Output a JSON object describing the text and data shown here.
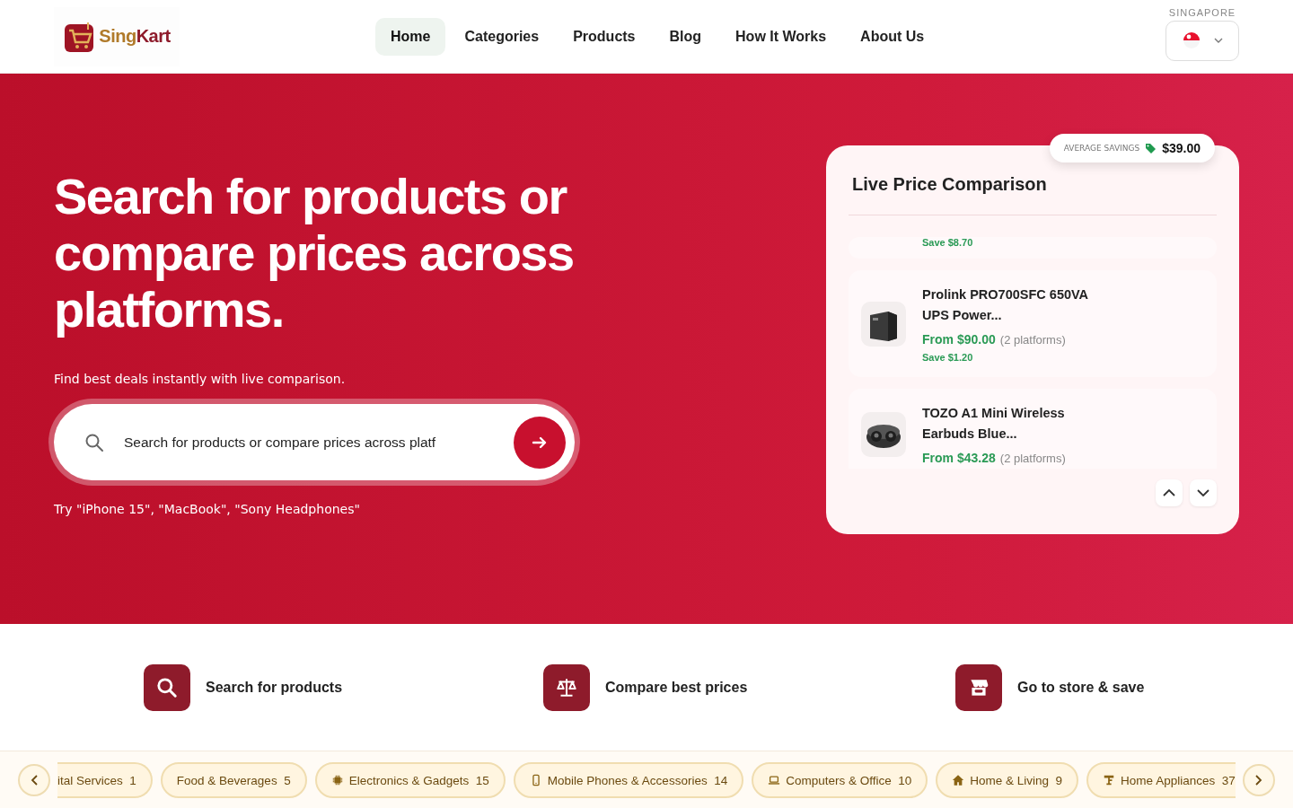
{
  "header": {
    "logo_parts": [
      "Sing",
      "Kart"
    ],
    "nav": [
      {
        "label": "Home",
        "selected": true
      },
      {
        "label": "Categories",
        "selected": false
      },
      {
        "label": "Products",
        "selected": false
      },
      {
        "label": "Blog",
        "selected": false
      },
      {
        "label": "How It Works",
        "selected": false
      },
      {
        "label": "About Us",
        "selected": false
      }
    ],
    "region_label": "SINGAPORE"
  },
  "hero": {
    "title": "Search for products or compare prices across platforms.",
    "subtitle": "Find best deals instantly with live comparison.",
    "search": {
      "placeholder": "Search for products or compare prices across platf"
    },
    "hint": "Try \"iPhone 15\", \"MacBook\", \"Sony Headphones\""
  },
  "comparison": {
    "badge_label": "AVERAGE SAVINGS",
    "badge_value": "$39.00",
    "title": "Live Price Comparison",
    "items": [
      {
        "saving": "Save $8.70"
      },
      {
        "kind": "ups",
        "name": "Prolink PRO700SFC 650VA UPS Power...",
        "price": "From $90.00",
        "platforms": "(2 platforms)",
        "saving": "Save $1.20"
      },
      {
        "kind": "earbuds",
        "name": "TOZO A1 Mini Wireless Earbuds Blue...",
        "price": "From $43.28",
        "platforms": "(2 platforms)"
      }
    ]
  },
  "steps": [
    {
      "kind": "search",
      "label": "Search for products"
    },
    {
      "kind": "scale",
      "label": "Compare best prices"
    },
    {
      "kind": "store",
      "label": "Go to store & save"
    }
  ],
  "categories": [
    {
      "kind": "none",
      "label": "ital Services",
      "count": "1"
    },
    {
      "kind": "none",
      "label": "Food & Beverages",
      "count": "5"
    },
    {
      "kind": "chip",
      "label": "Electronics & Gadgets",
      "count": "15"
    },
    {
      "kind": "phone",
      "label": "Mobile Phones & Accessories",
      "count": "14"
    },
    {
      "kind": "laptop",
      "label": "Computers & Office",
      "count": "10"
    },
    {
      "kind": "home",
      "label": "Home & Living",
      "count": "9"
    },
    {
      "kind": "appliance",
      "label": "Home Appliances",
      "count": "37"
    }
  ]
}
